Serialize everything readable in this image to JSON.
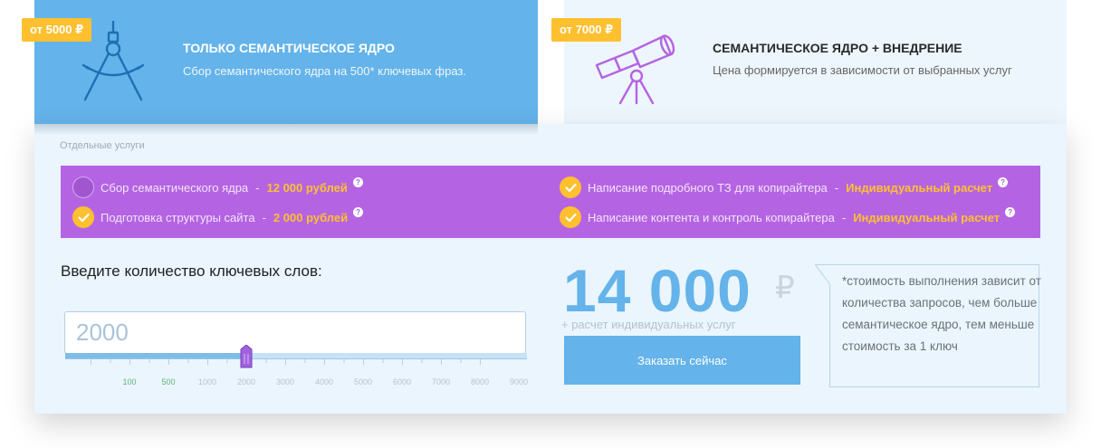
{
  "plans": [
    {
      "badge": "от 5000 ₽",
      "icon": "compass-icon",
      "title": "ТОЛЬКО СЕМАНТИЧЕСКОЕ ЯДРО",
      "description": "Сбор семантического ядра на 500* ключевых фраз."
    },
    {
      "badge": "от 7000 ₽",
      "icon": "telescope-icon",
      "title": "СЕМАНТИЧЕСКОЕ ЯДРО + ВНЕДРЕНИЕ",
      "description": "Цена формируется в зависимости от выбранных услуг"
    }
  ],
  "calculator": {
    "section_label": "Отдельные услуги",
    "services": [
      {
        "name": "Сбор семантического ядра",
        "separator": "-",
        "price": "12 000 рублей",
        "checked": false,
        "help": "?"
      },
      {
        "name": "Подготовка структуры сайта",
        "separator": "-",
        "price": "2 000 рублей",
        "checked": true,
        "help": "?"
      },
      {
        "name": "Написание подробного ТЗ для копирайтера",
        "separator": "-",
        "price": "Индивидуальный расчет",
        "checked": true,
        "help": "?"
      },
      {
        "name": "Написание контента и контроль копирайтера",
        "separator": "-",
        "price": "Индивидуальный расчет",
        "checked": true,
        "help": "?"
      }
    ],
    "keywords_label": "Введите количество ключевых слов:",
    "keywords_value": "2000",
    "slider": {
      "value": 2000,
      "labels": [
        "100",
        "500",
        "1000",
        "2000",
        "3000",
        "4000",
        "5000",
        "6000",
        "7000",
        "8000",
        "9000"
      ]
    },
    "total": "14 000",
    "currency": "₽",
    "total_note": "+ расчет индивидуальных услуг",
    "order_button": "Заказать сейчас",
    "note": "*стоимость выполнения зависит от количества запросов, чем больше семантическое ядро, тем меньше стоимость за 1 ключ"
  },
  "colors": {
    "accent_blue": "#64b3ea",
    "services_purple": "#b464e2",
    "badge_yellow": "#fec02f",
    "panel_bg": "#eaf5fd"
  }
}
